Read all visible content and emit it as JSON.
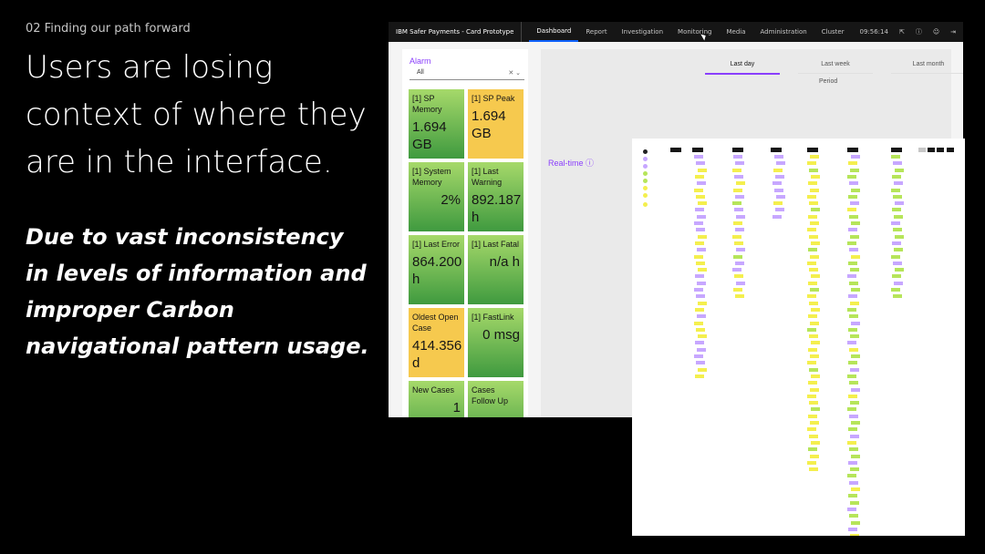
{
  "slide": {
    "eyebrow": "02 Finding our path forward",
    "headline": "Users are losing context of where they are in the interface.",
    "subline": "Due to vast inconsistency in levels of information and improper Carbon navigational pattern usage."
  },
  "app": {
    "brand": "IBM Safer Payments - Card Prototype",
    "nav": [
      "Dashboard",
      "Report",
      "Investigation",
      "Monitoring",
      "Media",
      "Administration",
      "Cluster"
    ],
    "active_nav": "Dashboard",
    "time": "09:56:14",
    "alarm_panel": {
      "title": "Alarm",
      "select_value": "All",
      "tiles": [
        {
          "label": "[1] SP Memory",
          "value": "1.694 GB",
          "color": "green"
        },
        {
          "label": "[1] SP Peak",
          "value": "1.694 GB",
          "color": "yellow"
        },
        {
          "label": "[1] System Memory",
          "value": "2%",
          "color": "green"
        },
        {
          "label": "[1] Last Warning",
          "value": "892.187 h",
          "color": "green"
        },
        {
          "label": "[1] Last Error",
          "value": "864.200 h",
          "color": "green"
        },
        {
          "label": "[1] Last Fatal",
          "value": "n/a h",
          "color": "green"
        },
        {
          "label": "Oldest Open Case",
          "value": "414.356 d",
          "color": "yellow"
        },
        {
          "label": "[1] FastLink",
          "value": "0 msg",
          "color": "green"
        },
        {
          "label": "New Cases",
          "value": "1",
          "color": "green"
        },
        {
          "label": "Cases Follow Up",
          "value": "",
          "color": "green"
        }
      ]
    },
    "period_tabs": [
      "Last day",
      "Last week",
      "Last month"
    ],
    "active_period": "Last day",
    "period_label": "Period",
    "realtime_label": "Real-time"
  },
  "colors": {
    "accent": "#8a3ffc",
    "tile_green": "#3f9a3f",
    "tile_yellow": "#f6c94e",
    "note_purple": "#c7a7ff",
    "note_yellow": "#f4ef4e",
    "note_green": "#b6e55a"
  },
  "icons": [
    "notification-icon",
    "help-icon",
    "user-icon",
    "logout-icon",
    "chevron-down-icon",
    "info-icon"
  ]
}
